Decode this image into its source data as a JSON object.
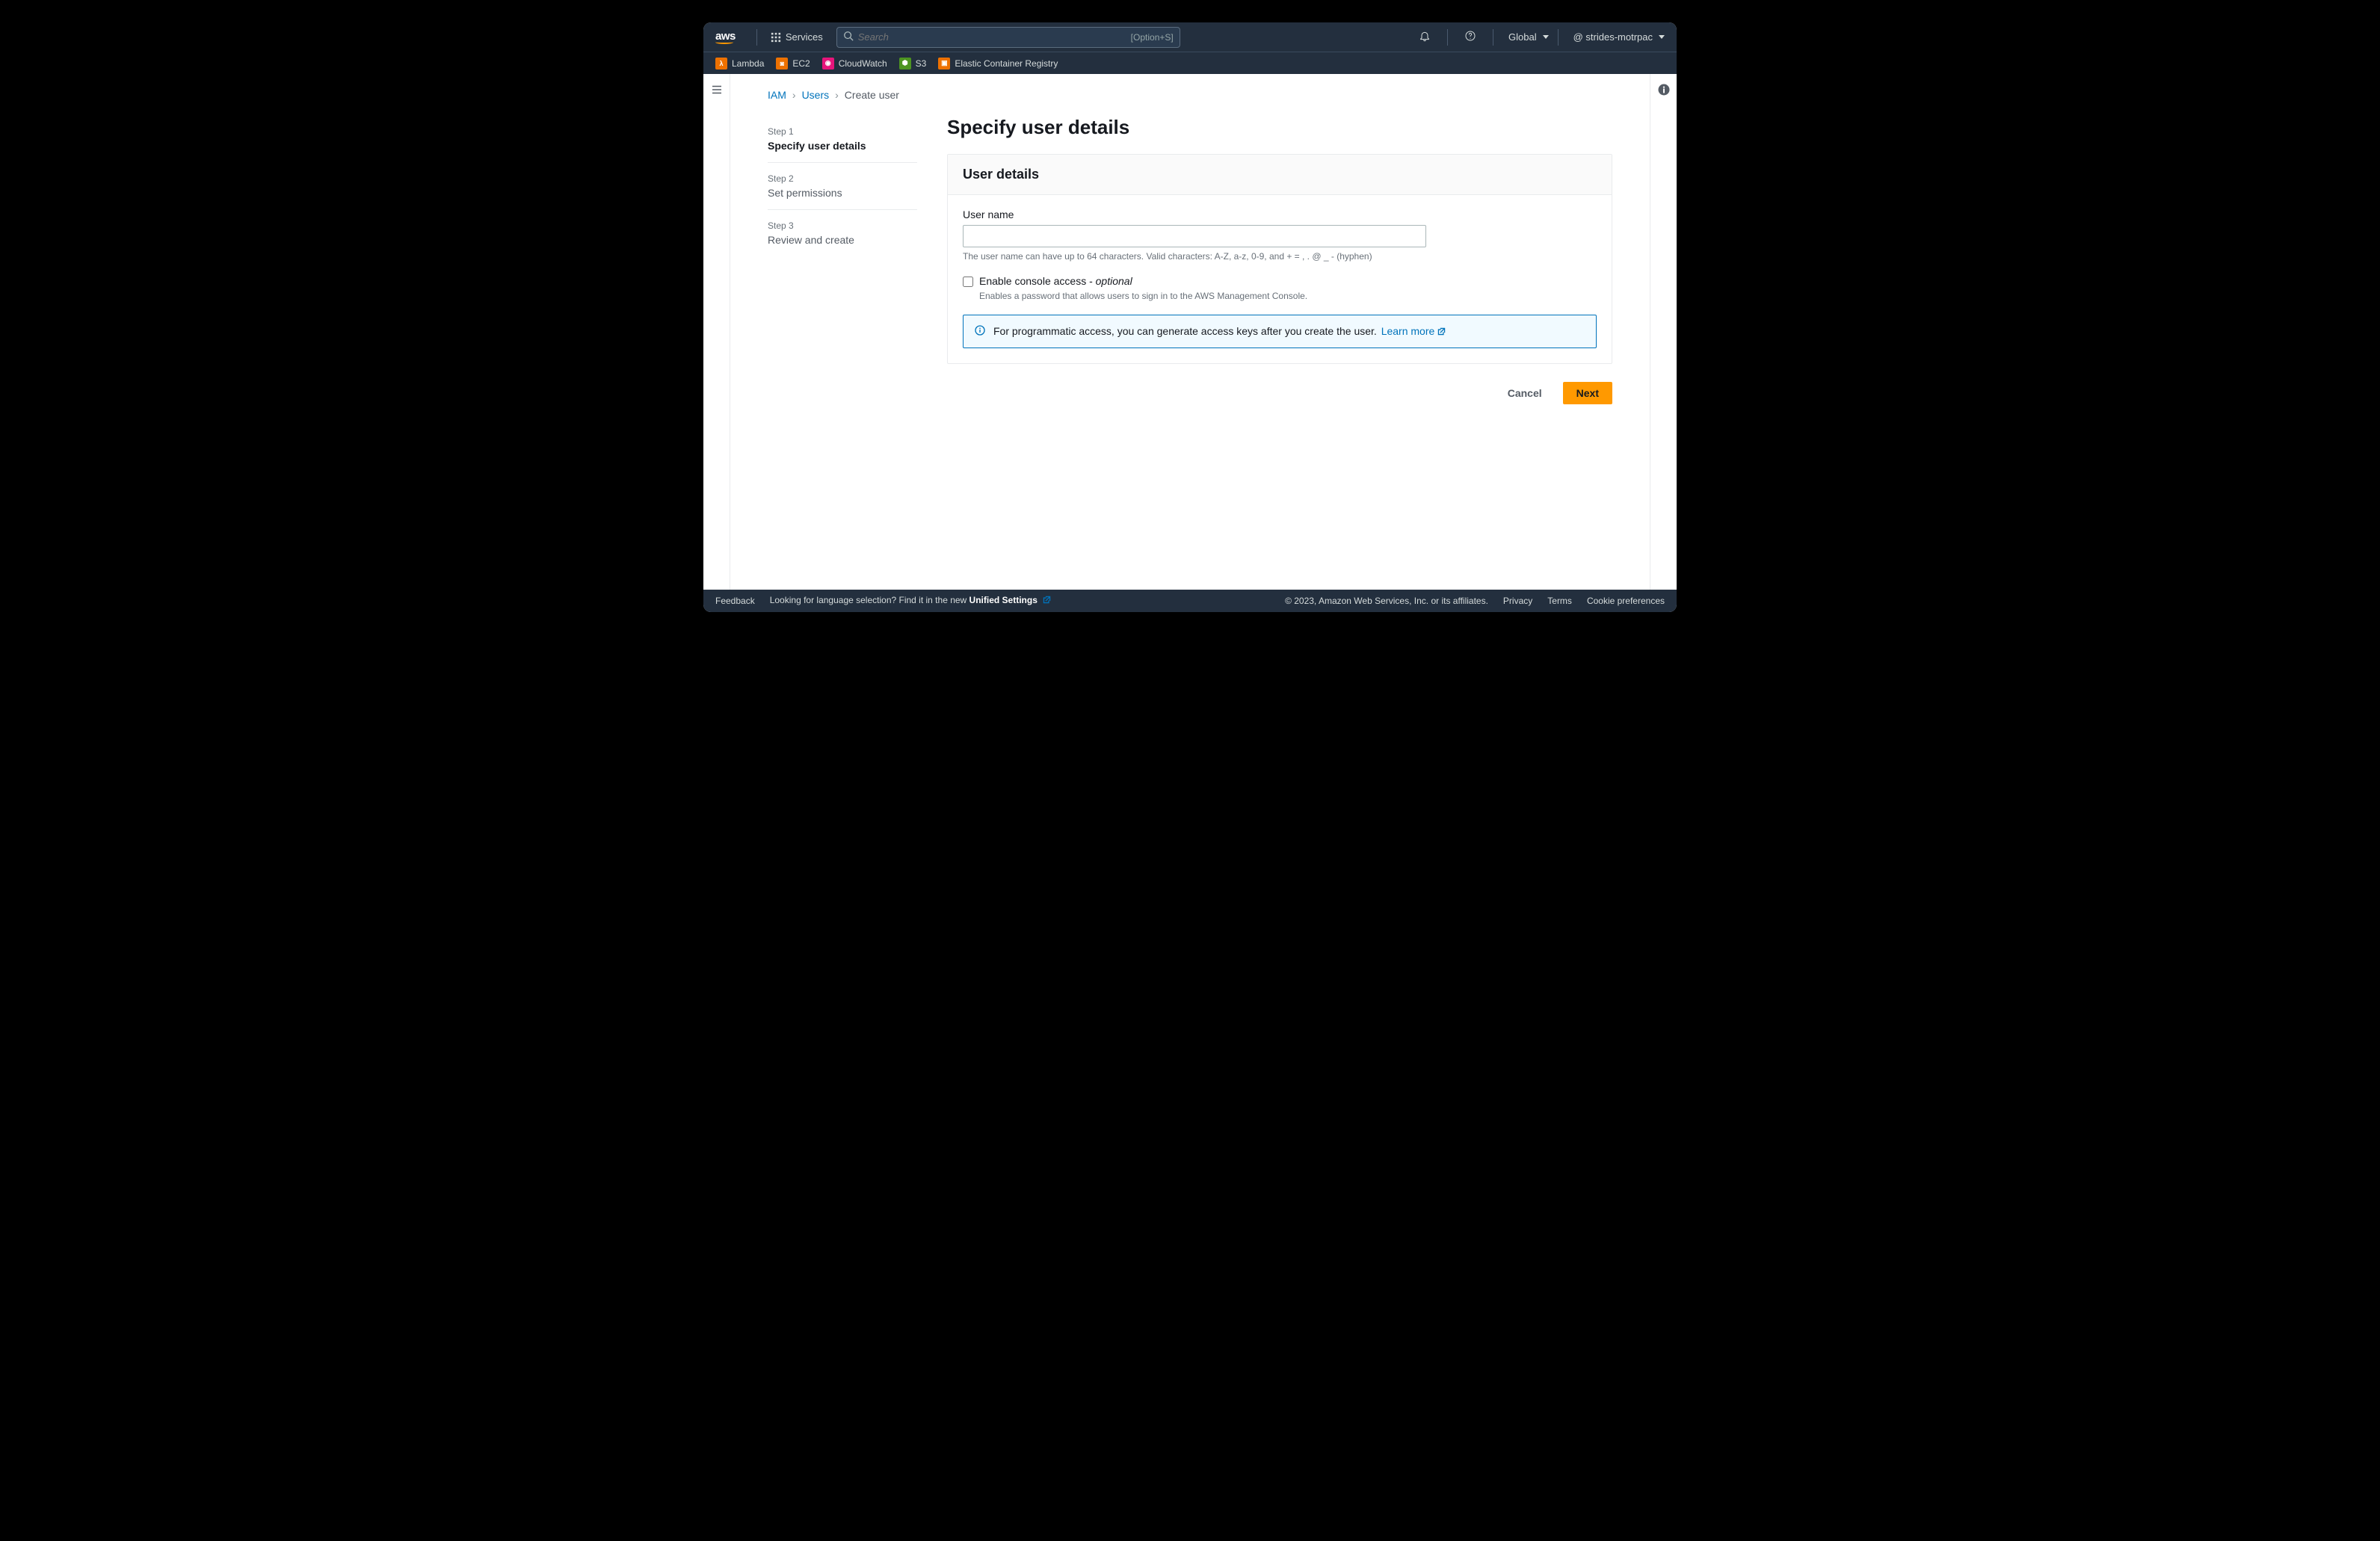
{
  "topnav": {
    "services_label": "Services",
    "search_placeholder": "Search",
    "search_shortcut": "[Option+S]",
    "region": "Global",
    "account": "@ strides-motrpac"
  },
  "shortcuts": {
    "lambda": "Lambda",
    "ec2": "EC2",
    "cloudwatch": "CloudWatch",
    "s3": "S3",
    "ecr": "Elastic Container Registry"
  },
  "breadcrumb": {
    "iam": "IAM",
    "users": "Users",
    "create": "Create user"
  },
  "steps": {
    "s1_num": "Step 1",
    "s1_title": "Specify user details",
    "s2_num": "Step 2",
    "s2_title": "Set permissions",
    "s3_num": "Step 3",
    "s3_title": "Review and create"
  },
  "page": {
    "title": "Specify user details",
    "panel_header": "User details",
    "username_label": "User name",
    "username_value": "",
    "username_hint": "The user name can have up to 64 characters. Valid characters: A-Z, a-z, 0-9, and + = , . @ _ - (hyphen)",
    "console_label": "Enable console access - ",
    "console_optional": "optional",
    "console_desc": "Enables a password that allows users to sign in to the AWS Management Console.",
    "info_text": "For programmatic access, you can generate access keys after you create the user.",
    "learn_more": "Learn more",
    "cancel": "Cancel",
    "next": "Next"
  },
  "footer": {
    "feedback": "Feedback",
    "lang_prompt": "Looking for language selection? Find it in the new ",
    "unified": "Unified Settings",
    "copyright": "© 2023, Amazon Web Services, Inc. or its affiliates.",
    "privacy": "Privacy",
    "terms": "Terms",
    "cookies": "Cookie preferences"
  }
}
